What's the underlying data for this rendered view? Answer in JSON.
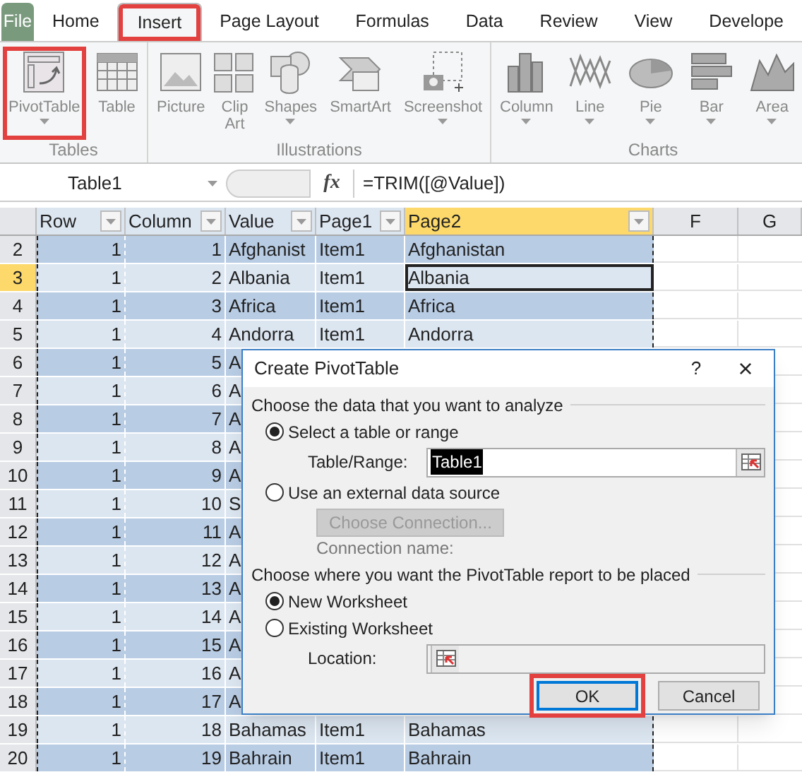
{
  "tabs": [
    {
      "label": "File",
      "selected": false,
      "kind": "file",
      "highlighted": false
    },
    {
      "label": "Home",
      "selected": false,
      "kind": "tab",
      "highlighted": false
    },
    {
      "label": "Insert",
      "selected": true,
      "kind": "tab",
      "highlighted": true
    },
    {
      "label": "Page Layout",
      "selected": false,
      "kind": "tab",
      "highlighted": false
    },
    {
      "label": "Formulas",
      "selected": false,
      "kind": "tab",
      "highlighted": false
    },
    {
      "label": "Data",
      "selected": false,
      "kind": "tab",
      "highlighted": false
    },
    {
      "label": "Review",
      "selected": false,
      "kind": "tab",
      "highlighted": false
    },
    {
      "label": "View",
      "selected": false,
      "kind": "tab",
      "highlighted": false
    },
    {
      "label": "Develope",
      "selected": false,
      "kind": "tab",
      "highlighted": false
    }
  ],
  "ribbon_groups": [
    {
      "label": "Tables",
      "buttons": [
        {
          "label": "PivotTable",
          "kind": "pivot",
          "has_menu": true,
          "highlighted": true
        },
        {
          "label": "Table",
          "kind": "table",
          "has_menu": false,
          "highlighted": false
        }
      ]
    },
    {
      "label": "Illustrations",
      "buttons": [
        {
          "label": "Picture",
          "kind": "picture",
          "has_menu": false,
          "highlighted": false
        },
        {
          "label": "Clip Art",
          "kind": "clipart",
          "has_menu": false,
          "highlighted": false
        },
        {
          "label": "Shapes",
          "kind": "shapes",
          "has_menu": true,
          "highlighted": false
        },
        {
          "label": "SmartArt",
          "kind": "smartart",
          "has_menu": false,
          "highlighted": false
        },
        {
          "label": "Screenshot",
          "kind": "screenshot",
          "has_menu": true,
          "highlighted": false
        }
      ]
    },
    {
      "label": "Charts",
      "buttons": [
        {
          "label": "Column",
          "kind": "column",
          "has_menu": true,
          "highlighted": false
        },
        {
          "label": "Line",
          "kind": "line",
          "has_menu": true,
          "highlighted": false
        },
        {
          "label": "Pie",
          "kind": "pie",
          "has_menu": true,
          "highlighted": false
        },
        {
          "label": "Bar",
          "kind": "bar",
          "has_menu": true,
          "highlighted": false
        },
        {
          "label": "Area",
          "kind": "area",
          "has_menu": true,
          "highlighted": false
        }
      ]
    }
  ],
  "formula_bar": {
    "name_box": "Table1",
    "fx": "fx",
    "formula": "=TRIM([@Value])"
  },
  "columns": [
    {
      "label": "Row",
      "filter": true,
      "selected": false
    },
    {
      "label": "Column",
      "filter": true,
      "selected": false
    },
    {
      "label": "Value",
      "filter": true,
      "selected": false
    },
    {
      "label": "Page1",
      "filter": true,
      "selected": false
    },
    {
      "label": "Page2",
      "filter": true,
      "selected": true
    },
    {
      "label": "F",
      "filter": false,
      "selected": false
    },
    {
      "label": "G",
      "filter": false,
      "selected": false
    }
  ],
  "rows": [
    {
      "number": "2",
      "selected": false,
      "cells": [
        "1",
        "1",
        "Afghanist",
        "Item1",
        "Afghanistan"
      ]
    },
    {
      "number": "3",
      "selected": true,
      "cells": [
        "1",
        "2",
        "Albania",
        "Item1",
        "Albania"
      ]
    },
    {
      "number": "4",
      "selected": false,
      "cells": [
        "1",
        "3",
        "Africa",
        "Item1",
        "Africa"
      ]
    },
    {
      "number": "5",
      "selected": false,
      "cells": [
        "1",
        "4",
        "Andorra",
        "Item1",
        "Andorra"
      ]
    },
    {
      "number": "6",
      "selected": false,
      "cells": [
        "1",
        "5",
        "A"
      ]
    },
    {
      "number": "7",
      "selected": false,
      "cells": [
        "1",
        "6",
        "A"
      ]
    },
    {
      "number": "8",
      "selected": false,
      "cells": [
        "1",
        "7",
        "A"
      ]
    },
    {
      "number": "9",
      "selected": false,
      "cells": [
        "1",
        "8",
        "A"
      ]
    },
    {
      "number": "10",
      "selected": false,
      "cells": [
        "1",
        "9",
        "A"
      ]
    },
    {
      "number": "11",
      "selected": false,
      "cells": [
        "1",
        "10",
        "S"
      ]
    },
    {
      "number": "12",
      "selected": false,
      "cells": [
        "1",
        "11",
        "A"
      ]
    },
    {
      "number": "13",
      "selected": false,
      "cells": [
        "1",
        "12",
        "A"
      ]
    },
    {
      "number": "14",
      "selected": false,
      "cells": [
        "1",
        "13",
        "A"
      ]
    },
    {
      "number": "15",
      "selected": false,
      "cells": [
        "1",
        "14",
        "A"
      ]
    },
    {
      "number": "16",
      "selected": false,
      "cells": [
        "1",
        "15",
        "A"
      ]
    },
    {
      "number": "17",
      "selected": false,
      "cells": [
        "1",
        "16",
        "A"
      ]
    },
    {
      "number": "18",
      "selected": false,
      "cells": [
        "1",
        "17",
        "A"
      ]
    },
    {
      "number": "19",
      "selected": false,
      "cells": [
        "1",
        "18",
        "Bahamas",
        "Item1",
        "Bahamas"
      ]
    },
    {
      "number": "20",
      "selected": false,
      "cells": [
        "1",
        "19",
        "Bahrain",
        "Item1",
        "Bahrain"
      ]
    }
  ],
  "dialog": {
    "title": "Create PivotTable",
    "help": "?",
    "close": "×",
    "sections": [
      {
        "heading": "Choose the data that you want to analyze",
        "options": [
          {
            "label": "Select a table or range",
            "selected": true,
            "field": {
              "label": "Table/Range:",
              "value": "Table1",
              "disabled": false
            }
          },
          {
            "label": "Use an external data source",
            "selected": false,
            "button": {
              "label": "Choose Connection...",
              "disabled": true
            },
            "note": "Connection name:"
          }
        ]
      },
      {
        "heading": "Choose where you want the PivotTable report to be placed",
        "options": [
          {
            "label": "New Worksheet",
            "selected": true
          },
          {
            "label": "Existing Worksheet",
            "selected": false,
            "field": {
              "label": "Location:",
              "disabled": true
            }
          }
        ]
      }
    ],
    "buttons": [
      {
        "label": "OK",
        "default": true,
        "highlighted": true
      },
      {
        "label": "Cancel",
        "default": false,
        "highlighted": false
      }
    ]
  }
}
